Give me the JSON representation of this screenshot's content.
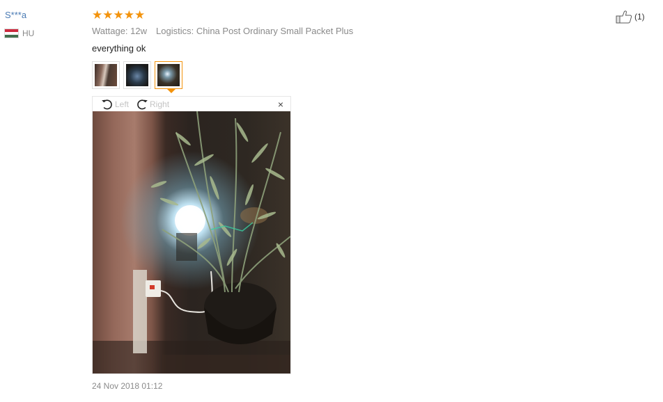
{
  "review": {
    "user_name": "S***a",
    "country_code": "HU",
    "flag_colors": [
      "#cd2a3e",
      "#ffffff",
      "#436f4d"
    ],
    "rating_stars": 5,
    "star_glyph": "★",
    "star_color": "#f3930c",
    "wattage": "Wattage: 12w",
    "logistics": "Logistics: China Post Ordinary Small Packet Plus",
    "text": "everything ok",
    "thumbnails": [
      {
        "name": "review-photo-1",
        "active": false
      },
      {
        "name": "review-photo-2",
        "active": false
      },
      {
        "name": "review-photo-3",
        "active": true
      }
    ],
    "viewer": {
      "rotate_left_label": "Left",
      "rotate_right_label": "Right",
      "close_glyph": "×"
    },
    "timestamp": "24 Nov 2018 01:12",
    "helpful_count": "(1)"
  },
  "icons": {
    "rotate_left": "rotate-left-icon",
    "rotate_right": "rotate-right-icon",
    "thumbs_up": "thumbs-up-icon",
    "close": "close-icon"
  },
  "accent_color": "#f3930c"
}
